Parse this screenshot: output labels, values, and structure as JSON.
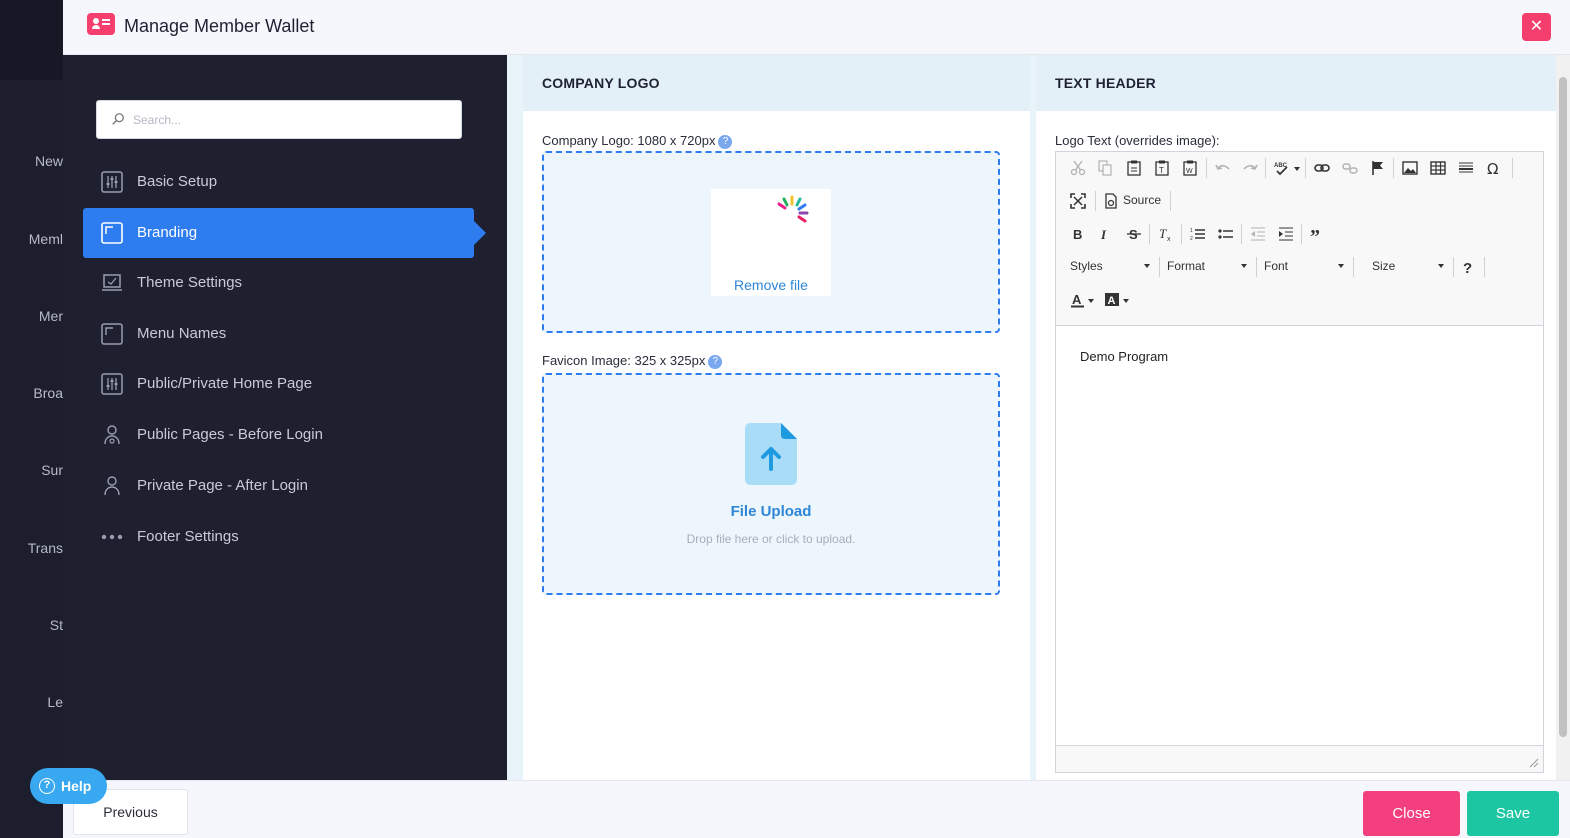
{
  "background_sidebar": {
    "items": [
      "New",
      "Meml",
      "Mer",
      "Broa",
      "Sur",
      "Trans",
      "St",
      "Le"
    ]
  },
  "modal": {
    "title": "Manage Member Wallet",
    "close_icon": "close-icon",
    "accent_color": "#f43f6e"
  },
  "nav": {
    "search_placeholder": "Search...",
    "items": [
      {
        "label": "Basic Setup",
        "icon": "sliders-icon"
      },
      {
        "label": "Branding",
        "icon": "frame-icon",
        "active": true
      },
      {
        "label": "Theme Settings",
        "icon": "laptop-icon"
      },
      {
        "label": "Menu Names",
        "icon": "frame-icon"
      },
      {
        "label": "Public/Private Home Page",
        "icon": "sliders-icon"
      },
      {
        "label": "Public Pages - Before Login",
        "icon": "user-lock-icon"
      },
      {
        "label": "Private Page - After Login",
        "icon": "user-icon"
      },
      {
        "label": "Footer Settings",
        "icon": "dots-icon"
      }
    ],
    "active_color": "#2d7cf0"
  },
  "help": {
    "label": "Help"
  },
  "company_logo": {
    "header": "COMPANY LOGO",
    "logo_label": "Company Logo: 1080 x 720px",
    "remove_file": "Remove file",
    "favicon_label": "Favicon Image: 325 x 325px",
    "upload_title": "File Upload",
    "upload_sub": "Drop file here or click to upload."
  },
  "text_header": {
    "header": "TEXT HEADER",
    "logo_text_label": "Logo Text (overrides image):",
    "toolbar": {
      "source": "Source",
      "styles": "Styles",
      "format": "Format",
      "font": "Font",
      "size": "Size"
    },
    "content": "Demo Program"
  },
  "footer": {
    "previous": "Previous",
    "close": "Close",
    "save": "Save",
    "close_color": "#f43f7e",
    "save_color": "#1cc6a3"
  }
}
